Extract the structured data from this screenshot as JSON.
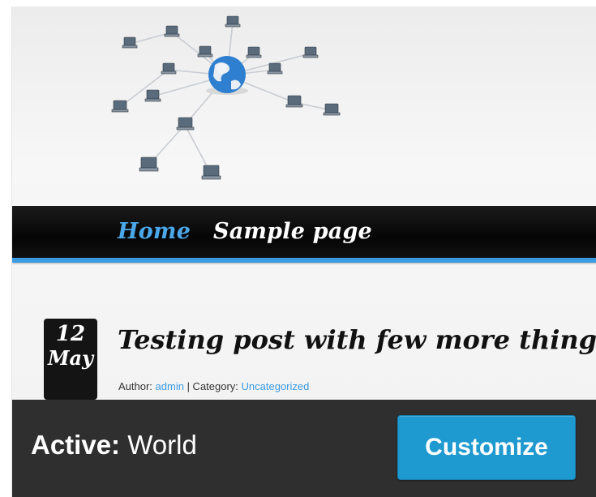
{
  "theme_preview": {
    "nav": {
      "home": "Home",
      "sample_page": "Sample page"
    },
    "post": {
      "date_day": "12",
      "date_month": "May",
      "title": "Testing post with few more things",
      "meta_author_label": "Author: ",
      "meta_author": "admin",
      "meta_sep": " | Category: ",
      "meta_category": "Uncategorized"
    },
    "header_image": "network-globe-illustration"
  },
  "footer": {
    "active_label": "Active:",
    "theme_name": "World",
    "customize_label": "Customize"
  },
  "colors": {
    "accent_blue": "#3a9be2",
    "button_blue": "#1e9ad0",
    "footer_bg": "#2f2f2f",
    "nav_bg": "#0b0b0b"
  }
}
